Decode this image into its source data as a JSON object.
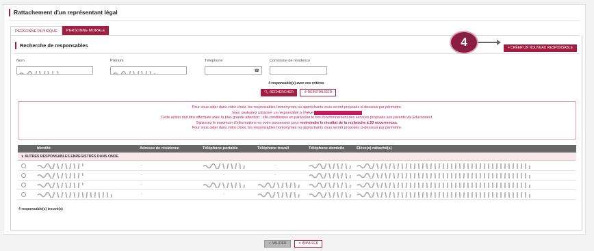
{
  "panel": {
    "title": "Rattachement d'un représentant légal"
  },
  "tabs": [
    {
      "label": "PERSONNE PHYSIQUE",
      "active": true
    },
    {
      "label": "PERSONNE MORALE",
      "active": false
    }
  ],
  "search": {
    "section_title": "Recherche de responsables",
    "create_button": "+ CRÉER UN NOUVEAU RESPONSABLE",
    "fields": [
      {
        "label": "Nom"
      },
      {
        "label": "Prénom"
      },
      {
        "label": "Téléphone"
      },
      {
        "label": "Commune de résidence"
      }
    ],
    "criteria_count": "4 responsable(s) avec ces critères",
    "search_button": "RECHERCHER",
    "reset_button": "RÉINITIALISER"
  },
  "warning": {
    "line1": "Pour vous aider dans votre choix, les responsables homonymes ou approchants vous seront proposés ci-dessous par périmètre.",
    "line2": "Vous souhaitez rattacher un responsable à l'élève",
    "line3": "Cette action doit être effectuée avec la plus grande attention : elle conditionne en particulier le bon fonctionnement des services proposés aux parents via Educonnect.",
    "line4_prefix": "Saisissez le maximum d'informations en votre possession pour",
    "line4_bold": "restreindre le résultat de la recherche à 20 occurrences.",
    "line5": "Pour vous aider dans votre choix, les responsables homonymes ou approchants vous seront proposés ci-dessous par périmètre."
  },
  "table": {
    "columns": [
      "Identité",
      "Adresse de résidence",
      "Téléphone portable",
      "Téléphone travail",
      "Téléphone domicile",
      "Élève(s) rattaché(s)"
    ],
    "group_label": "AUTRES RESPONSABLES ENREGISTRÉS DANS ONDE",
    "rows": [
      {
        "adresse": "-",
        "portable": "blur",
        "travail": "-",
        "domicile": "blur",
        "eleves": "blur"
      },
      {
        "adresse": "-",
        "portable": "-",
        "travail": "-",
        "domicile": "blur",
        "eleves": "blur"
      },
      {
        "adresse": "-",
        "portable": "blur",
        "travail": "blur",
        "domicile": "blur",
        "eleves": "blur"
      },
      {
        "adresse": "-",
        "portable": "-",
        "travail": "blur",
        "domicile": "blur",
        "eleves": "blur"
      }
    ],
    "found_count": "4 responsable(s) trouvé(s)"
  },
  "footer": {
    "valider": "VALIDER",
    "annuler": "ANNULER"
  },
  "callout": {
    "number": "4"
  },
  "colors": {
    "accent": "#a11e42",
    "callout": "#8a1e42",
    "warning_text": "#c2185b"
  }
}
